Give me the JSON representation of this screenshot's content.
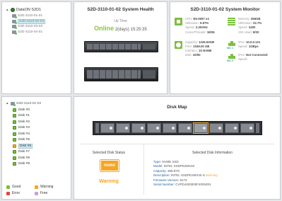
{
  "tree1": {
    "root": "DataON S2D1",
    "items": [
      {
        "label": "S2D-3110-01-01",
        "selected": false
      },
      {
        "label": "S2D-3110-01-02",
        "selected": true
      },
      {
        "label": "S2D-3110-03-03",
        "selected": false
      },
      {
        "label": "S2D-3110-04-01",
        "selected": false
      }
    ]
  },
  "health": {
    "title": "S2D-3110-01-02 System Health",
    "uptime_label": "Up Time",
    "status": "Online",
    "uptime": "2(days) 15:25:35"
  },
  "monitor": {
    "title": "S2D-3110-01-02 System Monitor",
    "cpu": {
      "label": "CPU:",
      "value": "E5-2697 v4",
      "utilization_label": "Utilization:",
      "utilization": "5.97%",
      "speed_label": "Speed:",
      "speed": "2.30GHz",
      "cores_label": "Cores/Threads:",
      "cores": "18/36"
    },
    "memory": {
      "label": "Memory:",
      "value": "256GB",
      "utilization_label": "Utilization:",
      "utilization": "22.7%",
      "speed_label": "Speed:",
      "speed": "2400",
      "slots_label": "Slot Used:",
      "slots": "8/20"
    },
    "disk": {
      "capacity_label": "Capacity:",
      "capacity": "1226.63GB",
      "free_label": "Free:",
      "free": "1049.00 GB",
      "interface_label": "Interface:",
      "interface": "10 NVME",
      "disk_label": "Disk:",
      "disk": "10/50"
    },
    "nic1": {
      "name": "NIC 1",
      "ipv4_label": "IPv4:",
      "ipv4": "10.0.0.121",
      "speed_label": "Speed:",
      "speed": "1GBps"
    },
    "nic2": {
      "name": "NIC 2",
      "ipv4_label": "IPv4:",
      "ipv4": "Not Connected",
      "speed_label": "Speed:",
      "speed": ""
    }
  },
  "tree2": {
    "root": "S2D-3110-01-02",
    "disks": [
      {
        "label": "Disk #0",
        "status": "good",
        "selected": false
      },
      {
        "label": "Disk #1",
        "status": "good",
        "selected": false
      },
      {
        "label": "Disk #2",
        "status": "good",
        "selected": false
      },
      {
        "label": "Disk #3",
        "status": "good",
        "selected": false
      },
      {
        "label": "Disk #4",
        "status": "good",
        "selected": false
      },
      {
        "label": "Disk #5",
        "status": "good",
        "selected": false
      },
      {
        "label": "Disk #6",
        "status": "warning",
        "selected": true
      },
      {
        "label": "Disk #7",
        "status": "good",
        "selected": false
      },
      {
        "label": "Disk #8",
        "status": "good",
        "selected": false
      },
      {
        "label": "Disk #9",
        "status": "good",
        "selected": false
      }
    ],
    "legend": {
      "good": "Good",
      "warning": "Warning",
      "error": "Error",
      "free": "Free"
    }
  },
  "colors": {
    "good": "#7bbf3f",
    "warning": "#f5a623",
    "error": "#e8453c",
    "free": "#c9a0dc",
    "online": "#8ac53f"
  },
  "diskmap": {
    "title": "Disk Map",
    "selected_status_title": "Selected Disk Status",
    "badge": "nvme",
    "status": "Warning",
    "info_title": "Selected Disk Information",
    "info": {
      "type_label": "Type:",
      "type": "NVME SSD",
      "model_label": "Model:",
      "model": "INTEL SSDPE2MX40",
      "capacity_label": "Capacity:",
      "capacity": "369.97G",
      "description_label": "Description:",
      "description": "INTEL SSDPE2MX40 is",
      "description_warn": "Warning",
      "firmware_label": "Firmware Version:",
      "firmware": "8174",
      "serial_label": "Serial Number:",
      "serial": "CVPD4403000F400NGN"
    }
  }
}
